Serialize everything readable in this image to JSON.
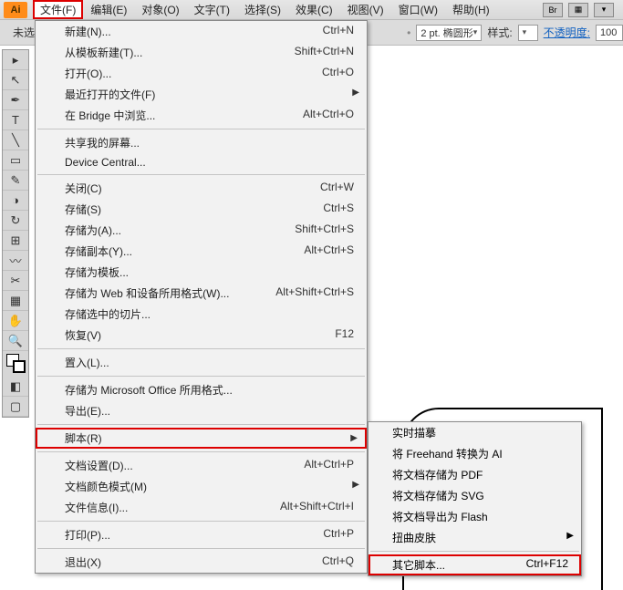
{
  "menubar": {
    "items": [
      "文件(F)",
      "编辑(E)",
      "对象(O)",
      "文字(T)",
      "选择(S)",
      "效果(C)",
      "视图(V)",
      "窗口(W)",
      "帮助(H)"
    ],
    "right": [
      "Br",
      "▦",
      "▾"
    ]
  },
  "toolbar2": {
    "doc_label": "未选",
    "stroke_label": "2 pt. 椭圆形",
    "style_label": "样式:",
    "opacity_label": "不透明度:",
    "opacity_value": "100"
  },
  "toolbox": {
    "tools": [
      "▸",
      "↖",
      "✒",
      "T",
      "╲",
      "▭",
      "✎",
      "◑",
      "↻",
      "⊞",
      "〰",
      "✂",
      "▦",
      "✋",
      "🔍"
    ]
  },
  "file_menu": {
    "groups": [
      [
        {
          "label": "新建(N)...",
          "shortcut": "Ctrl+N"
        },
        {
          "label": "从模板新建(T)...",
          "shortcut": "Shift+Ctrl+N"
        },
        {
          "label": "打开(O)...",
          "shortcut": "Ctrl+O"
        },
        {
          "label": "最近打开的文件(F)",
          "shortcut": "",
          "arrow": true
        },
        {
          "label": "在 Bridge 中浏览...",
          "shortcut": "Alt+Ctrl+O"
        }
      ],
      [
        {
          "label": "共享我的屏幕...",
          "shortcut": ""
        },
        {
          "label": "Device Central...",
          "shortcut": ""
        }
      ],
      [
        {
          "label": "关闭(C)",
          "shortcut": "Ctrl+W"
        },
        {
          "label": "存储(S)",
          "shortcut": "Ctrl+S"
        },
        {
          "label": "存储为(A)...",
          "shortcut": "Shift+Ctrl+S"
        },
        {
          "label": "存储副本(Y)...",
          "shortcut": "Alt+Ctrl+S"
        },
        {
          "label": "存储为模板...",
          "shortcut": ""
        },
        {
          "label": "存储为 Web 和设备所用格式(W)...",
          "shortcut": "Alt+Shift+Ctrl+S"
        },
        {
          "label": "存储选中的切片...",
          "shortcut": ""
        },
        {
          "label": "恢复(V)",
          "shortcut": "F12"
        }
      ],
      [
        {
          "label": "置入(L)...",
          "shortcut": ""
        }
      ],
      [
        {
          "label": "存储为 Microsoft Office 所用格式...",
          "shortcut": ""
        },
        {
          "label": "导出(E)...",
          "shortcut": ""
        }
      ],
      [
        {
          "label": "脚本(R)",
          "shortcut": "",
          "arrow": true,
          "highlight": true
        }
      ],
      [
        {
          "label": "文档设置(D)...",
          "shortcut": "Alt+Ctrl+P"
        },
        {
          "label": "文档颜色模式(M)",
          "shortcut": "",
          "arrow": true
        },
        {
          "label": "文件信息(I)...",
          "shortcut": "Alt+Shift+Ctrl+I"
        }
      ],
      [
        {
          "label": "打印(P)...",
          "shortcut": "Ctrl+P"
        }
      ],
      [
        {
          "label": "退出(X)",
          "shortcut": "Ctrl+Q"
        }
      ]
    ]
  },
  "script_submenu": {
    "groups": [
      [
        {
          "label": "实时描摹"
        },
        {
          "label": "将 Freehand 转换为 AI"
        },
        {
          "label": "将文档存储为 PDF"
        },
        {
          "label": "将文档存储为 SVG"
        },
        {
          "label": "将文档导出为 Flash"
        },
        {
          "label": "扭曲皮肤",
          "arrow": true
        }
      ],
      [
        {
          "label": "其它脚本...",
          "shortcut": "Ctrl+F12",
          "highlight": true
        }
      ]
    ]
  }
}
